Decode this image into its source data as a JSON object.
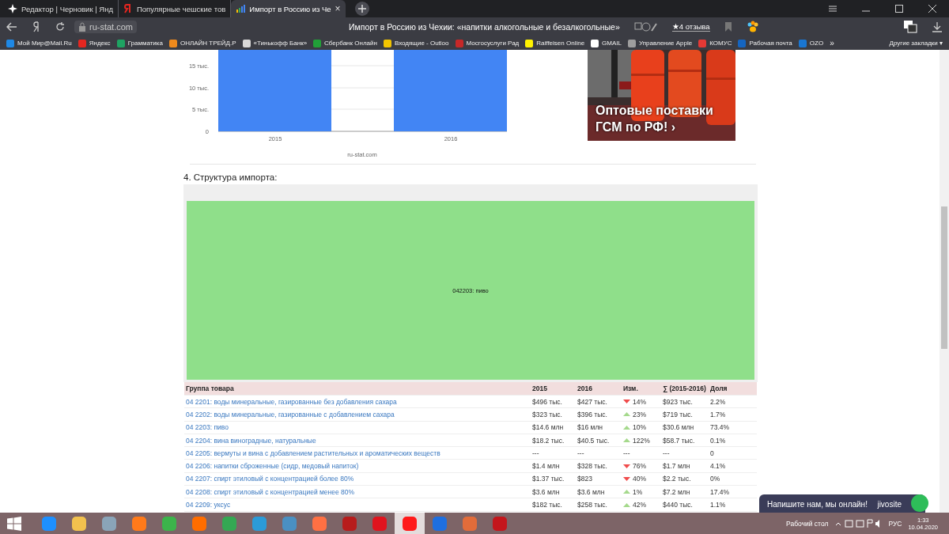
{
  "browser": {
    "tabs": [
      {
        "title": "Редактор | Черновик | Янд",
        "selected": false
      },
      {
        "title": "Популярные чешские тов",
        "selected": false
      },
      {
        "title": "Импорт в Россию из Че",
        "selected": true
      }
    ],
    "tab_close": "×",
    "address": "ru-stat.com",
    "page_title": "Импорт в Россию из Чехии: «напитки алкогольные и безалкогольные»",
    "reviews": "★4 отзыва",
    "bookmarks": [
      {
        "label": "Мой Мир@Mail.Ru",
        "color": "#1e88e5"
      },
      {
        "label": "Яндекс",
        "color": "#e52620"
      },
      {
        "label": "Грамматика",
        "color": "#1ea362"
      },
      {
        "label": "ОНЛАЙН ТРЕЙД.Р",
        "color": "#f08a1c"
      },
      {
        "label": "«Тинькофф Банк»",
        "color": "#d9d9d9"
      },
      {
        "label": "Сбербанк Онлайн",
        "color": "#21a038"
      },
      {
        "label": "Входящие - Outloo",
        "color": "#f2c400"
      },
      {
        "label": "Мосгосуслуги Рад",
        "color": "#c62828"
      },
      {
        "label": "Raiffeisen Online",
        "color": "#fff200"
      },
      {
        "label": "GMAIL",
        "color": "#ffffff"
      },
      {
        "label": "Управление Apple",
        "color": "#9e9e9e"
      },
      {
        "label": "КОМУС",
        "color": "#e53935"
      },
      {
        "label": "Рабочая почта",
        "color": "#1565c0"
      },
      {
        "label": "OZO",
        "color": "#1976d2"
      }
    ],
    "more": "»",
    "other_bookmarks": "Другие закладки ▾"
  },
  "page": {
    "chart": {
      "ytick_labels": [
        "15 тыс.",
        "10 тыс.",
        "5 тыс.",
        "0"
      ],
      "categories": [
        "2015",
        "2016"
      ],
      "source": "ru-stat.com"
    },
    "ad": {
      "kind": "picture",
      "text": "Оптовые поставки ГСМ по РФ! ›"
    },
    "section_title": "4. Структура импорта:",
    "treemap": {
      "label": "042203: пиво"
    },
    "table": {
      "columns": [
        "Группа товара",
        "2015",
        "2016",
        "Изм.",
        "∑ (2015-2016)",
        "Доля"
      ],
      "rows": [
        {
          "group": "04 2201: воды минеральные, газированные без добавления сахара",
          "y2015": "$496 тыс.",
          "y2016": "$427 тыс.",
          "kind": "down",
          "change": "14%",
          "total": "$923 тыс.",
          "share": "2.2%"
        },
        {
          "group": "04 2202: воды минеральные, газированные с добавлением сахара",
          "y2015": "$323 тыс.",
          "y2016": "$396 тыс.",
          "kind": "up",
          "change": "23%",
          "total": "$719 тыс.",
          "share": "1.7%"
        },
        {
          "group": "04 2203: пиво",
          "y2015": "$14.6 млн",
          "y2016": "$16 млн",
          "kind": "up",
          "change": "10%",
          "total": "$30.6 млн",
          "share": "73.4%"
        },
        {
          "group": "04 2204: вина виноградные, натуральные",
          "y2015": "$18.2 тыс.",
          "y2016": "$40.5 тыс.",
          "kind": "up",
          "change": "122%",
          "total": "$58.7 тыс.",
          "share": "0.1%"
        },
        {
          "group": "04 2205: вермуты и вина с добавлением растительных и ароматических веществ",
          "y2015": "---",
          "y2016": "---",
          "kind": "plain",
          "change": "---",
          "total": "---",
          "share": "0"
        },
        {
          "group": "04 2206: напитки сброженные (сидр, медовый напиток)",
          "y2015": "$1.4 млн",
          "y2016": "$328 тыс.",
          "kind": "down",
          "change": "76%",
          "total": "$1.7 млн",
          "share": "4.1%"
        },
        {
          "group": "04 2207: спирт этиловый с концентрацией более 80%",
          "y2015": "$1.37 тыс.",
          "y2016": "$823",
          "kind": "down",
          "change": "40%",
          "total": "$2.2 тыс.",
          "share": "0%"
        },
        {
          "group": "04 2208: спирт этиловый с концентрацией менее 80%",
          "y2015": "$3.6 млн",
          "y2016": "$3.6 млн",
          "kind": "up",
          "change": "1%",
          "total": "$7.2 млн",
          "share": "17.4%"
        },
        {
          "group": "04 2209: уксус",
          "y2015": "$182 тыс.",
          "y2016": "$258 тыс.",
          "kind": "up",
          "change": "42%",
          "total": "$440 тыс.",
          "share": "1.1%"
        }
      ]
    }
  },
  "chat": {
    "text": "Напишите нам, мы онлайн!",
    "brand": "jivosite"
  },
  "taskbar": {
    "apps": [
      {
        "color": "#1e90ff",
        "selected": false
      },
      {
        "color": "#f2c14e",
        "selected": false
      },
      {
        "color": "#8aa4b8",
        "selected": false
      },
      {
        "color": "#ff7a1a",
        "selected": false
      },
      {
        "color": "#3cb44b",
        "selected": false
      },
      {
        "color": "#ff6d00",
        "selected": false
      },
      {
        "color": "#34a853",
        "selected": false
      },
      {
        "color": "#2b9bd8",
        "selected": false
      },
      {
        "color": "#4a90c2",
        "selected": false
      },
      {
        "color": "#ff7043",
        "selected": false
      },
      {
        "color": "#b71c1c",
        "selected": false
      },
      {
        "color": "#e0141e",
        "selected": false
      },
      {
        "color": "#ff1a1a",
        "selected": true
      },
      {
        "color": "#1e6fe0",
        "selected": false
      },
      {
        "color": "#e26c3a",
        "selected": false
      },
      {
        "color": "#c4161c",
        "selected": false
      }
    ],
    "desktop": "Рабочий стол",
    "lang": "РУС",
    "time": "1:33",
    "date": "10.04.2020"
  }
}
